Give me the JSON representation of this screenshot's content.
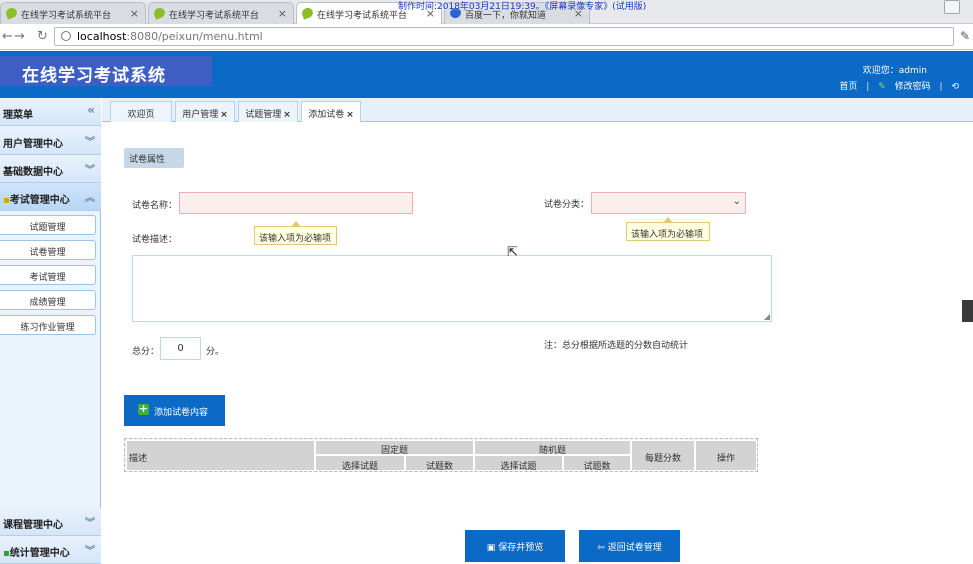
{
  "browser": {
    "tabs": [
      {
        "title": "在线学习考试系统平台",
        "close": "×"
      },
      {
        "title": "在线学习考试系统平台",
        "close": "×"
      },
      {
        "title": "在线学习考试系统平台",
        "close": "×"
      },
      {
        "title": "百度一下，你就知道",
        "close": "×"
      }
    ],
    "recording_overlay": "制作时间:2018年03月21日19:39。《屏幕录像专家》(试用版)",
    "url_host": "localhost",
    "url_path": ":8080/peixun/menu.html"
  },
  "header": {
    "app_title": "在线学习考试系统",
    "welcome": "欢迎您：admin",
    "home_link": "首页",
    "change_password_link": "修改密码"
  },
  "sidebar": {
    "title": "理菜单",
    "collapse": "«",
    "groups": [
      {
        "label": "用户管理中心",
        "chevron": "︾"
      },
      {
        "label": "基础数据中心",
        "chevron": "︾"
      },
      {
        "label": "考试管理中心",
        "chevron": "︽"
      }
    ],
    "items": [
      "试题管理",
      "试卷管理",
      "考试管理",
      "成绩管理",
      "练习作业管理"
    ],
    "bottom_groups": [
      {
        "label": "课程管理中心",
        "chevron": "︾"
      },
      {
        "label": "统计管理中心",
        "chevron": "︾"
      }
    ]
  },
  "content_tabs": [
    {
      "label": "欢迎页",
      "close": ""
    },
    {
      "label": "用户管理",
      "close": "×"
    },
    {
      "label": "试题管理",
      "close": "×"
    },
    {
      "label": "添加试卷",
      "close": "×"
    }
  ],
  "form": {
    "section": "试卷属性",
    "name_label": "试卷名称：",
    "category_label": "试卷分类：",
    "required_tip": "该输入项为必输项",
    "desc_label": "试卷描述：",
    "total_label": "总分：",
    "total_value": "0",
    "total_unit": "分。",
    "note": "注：总分根据所选题的分数自动统计",
    "add_button": "添加试卷内容"
  },
  "table": {
    "col_desc": "描述",
    "col_fixed": "固定题",
    "col_random": "随机题",
    "col_score": "每题分数",
    "col_action": "操作",
    "sub_select": "选择试题",
    "sub_count": "试题数"
  },
  "actions": {
    "save": "保存并预览",
    "back": "返回试卷管理"
  },
  "colors": {
    "accent": "#0a6ac6",
    "logo_bg": "#3d5ec3"
  }
}
